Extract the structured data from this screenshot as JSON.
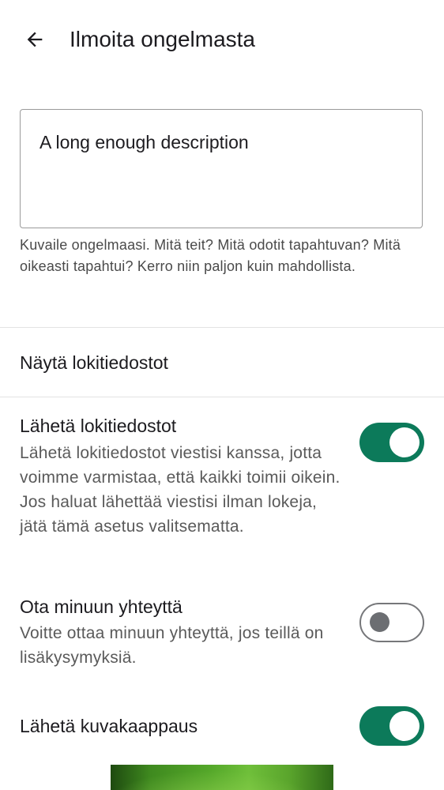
{
  "app_bar": {
    "title": "Ilmoita ongelmasta",
    "back_icon": "arrow-back-icon"
  },
  "description": {
    "value": "A long enough description",
    "helper": "Kuvaile ongelmaasi. Mitä teit? Mitä odotit tapahtuvan? Mitä oikeasti tapahtui? Kerro niin paljon kuin mahdollista."
  },
  "show_logs": {
    "label": "Näytä lokitiedostot"
  },
  "settings": [
    {
      "title": "Lähetä lokitiedostot",
      "description": "Lähetä lokitiedostot viestisi kanssa, jotta voimme varmistaa, että kaikki toimii oikein. Jos haluat lähettää viestisi ilman lokeja, jätä tämä asetus valitsematta.",
      "enabled": true
    },
    {
      "title": "Ota minuun yhteyttä",
      "description": "Voitte ottaa minuun yhteyttä, jos teillä on lisäkysymyksiä.",
      "enabled": false
    },
    {
      "title": "Lähetä kuvakaappaus",
      "enabled": true
    }
  ],
  "colors": {
    "switch_on": "#0c7a5a",
    "switch_off_border": "#76777a",
    "text_primary": "#1c1b1f",
    "text_secondary": "#5a5a5a"
  }
}
